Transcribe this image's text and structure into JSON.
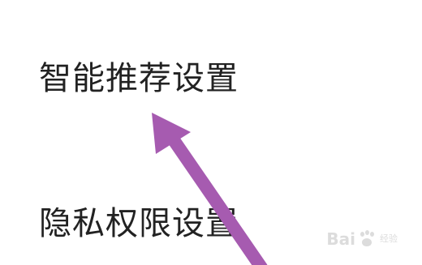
{
  "menu": {
    "items": [
      {
        "label": "智能推荐设置"
      },
      {
        "label": "隐私权限设置"
      }
    ]
  },
  "watermark": {
    "brand_left": "Bai",
    "brand_right": "经验",
    "paw_icon": "paw-print-icon"
  },
  "colors": {
    "background": "#ffffff",
    "text": "#222222",
    "arrow": "#a65bb0",
    "watermark": "#d9d9d9"
  }
}
